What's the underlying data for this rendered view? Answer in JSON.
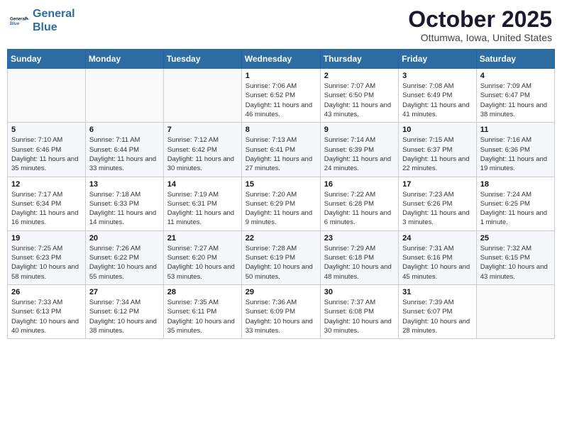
{
  "header": {
    "logo_line1": "General",
    "logo_line2": "Blue",
    "title": "October 2025",
    "subtitle": "Ottumwa, Iowa, United States"
  },
  "days_of_week": [
    "Sunday",
    "Monday",
    "Tuesday",
    "Wednesday",
    "Thursday",
    "Friday",
    "Saturday"
  ],
  "weeks": [
    [
      {
        "day": "",
        "info": ""
      },
      {
        "day": "",
        "info": ""
      },
      {
        "day": "",
        "info": ""
      },
      {
        "day": "1",
        "info": "Sunrise: 7:06 AM\nSunset: 6:52 PM\nDaylight: 11 hours and 46 minutes."
      },
      {
        "day": "2",
        "info": "Sunrise: 7:07 AM\nSunset: 6:50 PM\nDaylight: 11 hours and 43 minutes."
      },
      {
        "day": "3",
        "info": "Sunrise: 7:08 AM\nSunset: 6:49 PM\nDaylight: 11 hours and 41 minutes."
      },
      {
        "day": "4",
        "info": "Sunrise: 7:09 AM\nSunset: 6:47 PM\nDaylight: 11 hours and 38 minutes."
      }
    ],
    [
      {
        "day": "5",
        "info": "Sunrise: 7:10 AM\nSunset: 6:46 PM\nDaylight: 11 hours and 35 minutes."
      },
      {
        "day": "6",
        "info": "Sunrise: 7:11 AM\nSunset: 6:44 PM\nDaylight: 11 hours and 33 minutes."
      },
      {
        "day": "7",
        "info": "Sunrise: 7:12 AM\nSunset: 6:42 PM\nDaylight: 11 hours and 30 minutes."
      },
      {
        "day": "8",
        "info": "Sunrise: 7:13 AM\nSunset: 6:41 PM\nDaylight: 11 hours and 27 minutes."
      },
      {
        "day": "9",
        "info": "Sunrise: 7:14 AM\nSunset: 6:39 PM\nDaylight: 11 hours and 24 minutes."
      },
      {
        "day": "10",
        "info": "Sunrise: 7:15 AM\nSunset: 6:37 PM\nDaylight: 11 hours and 22 minutes."
      },
      {
        "day": "11",
        "info": "Sunrise: 7:16 AM\nSunset: 6:36 PM\nDaylight: 11 hours and 19 minutes."
      }
    ],
    [
      {
        "day": "12",
        "info": "Sunrise: 7:17 AM\nSunset: 6:34 PM\nDaylight: 11 hours and 16 minutes."
      },
      {
        "day": "13",
        "info": "Sunrise: 7:18 AM\nSunset: 6:33 PM\nDaylight: 11 hours and 14 minutes."
      },
      {
        "day": "14",
        "info": "Sunrise: 7:19 AM\nSunset: 6:31 PM\nDaylight: 11 hours and 11 minutes."
      },
      {
        "day": "15",
        "info": "Sunrise: 7:20 AM\nSunset: 6:29 PM\nDaylight: 11 hours and 9 minutes."
      },
      {
        "day": "16",
        "info": "Sunrise: 7:22 AM\nSunset: 6:28 PM\nDaylight: 11 hours and 6 minutes."
      },
      {
        "day": "17",
        "info": "Sunrise: 7:23 AM\nSunset: 6:26 PM\nDaylight: 11 hours and 3 minutes."
      },
      {
        "day": "18",
        "info": "Sunrise: 7:24 AM\nSunset: 6:25 PM\nDaylight: 11 hours and 1 minute."
      }
    ],
    [
      {
        "day": "19",
        "info": "Sunrise: 7:25 AM\nSunset: 6:23 PM\nDaylight: 10 hours and 58 minutes."
      },
      {
        "day": "20",
        "info": "Sunrise: 7:26 AM\nSunset: 6:22 PM\nDaylight: 10 hours and 55 minutes."
      },
      {
        "day": "21",
        "info": "Sunrise: 7:27 AM\nSunset: 6:20 PM\nDaylight: 10 hours and 53 minutes."
      },
      {
        "day": "22",
        "info": "Sunrise: 7:28 AM\nSunset: 6:19 PM\nDaylight: 10 hours and 50 minutes."
      },
      {
        "day": "23",
        "info": "Sunrise: 7:29 AM\nSunset: 6:18 PM\nDaylight: 10 hours and 48 minutes."
      },
      {
        "day": "24",
        "info": "Sunrise: 7:31 AM\nSunset: 6:16 PM\nDaylight: 10 hours and 45 minutes."
      },
      {
        "day": "25",
        "info": "Sunrise: 7:32 AM\nSunset: 6:15 PM\nDaylight: 10 hours and 43 minutes."
      }
    ],
    [
      {
        "day": "26",
        "info": "Sunrise: 7:33 AM\nSunset: 6:13 PM\nDaylight: 10 hours and 40 minutes."
      },
      {
        "day": "27",
        "info": "Sunrise: 7:34 AM\nSunset: 6:12 PM\nDaylight: 10 hours and 38 minutes."
      },
      {
        "day": "28",
        "info": "Sunrise: 7:35 AM\nSunset: 6:11 PM\nDaylight: 10 hours and 35 minutes."
      },
      {
        "day": "29",
        "info": "Sunrise: 7:36 AM\nSunset: 6:09 PM\nDaylight: 10 hours and 33 minutes."
      },
      {
        "day": "30",
        "info": "Sunrise: 7:37 AM\nSunset: 6:08 PM\nDaylight: 10 hours and 30 minutes."
      },
      {
        "day": "31",
        "info": "Sunrise: 7:39 AM\nSunset: 6:07 PM\nDaylight: 10 hours and 28 minutes."
      },
      {
        "day": "",
        "info": ""
      }
    ]
  ]
}
